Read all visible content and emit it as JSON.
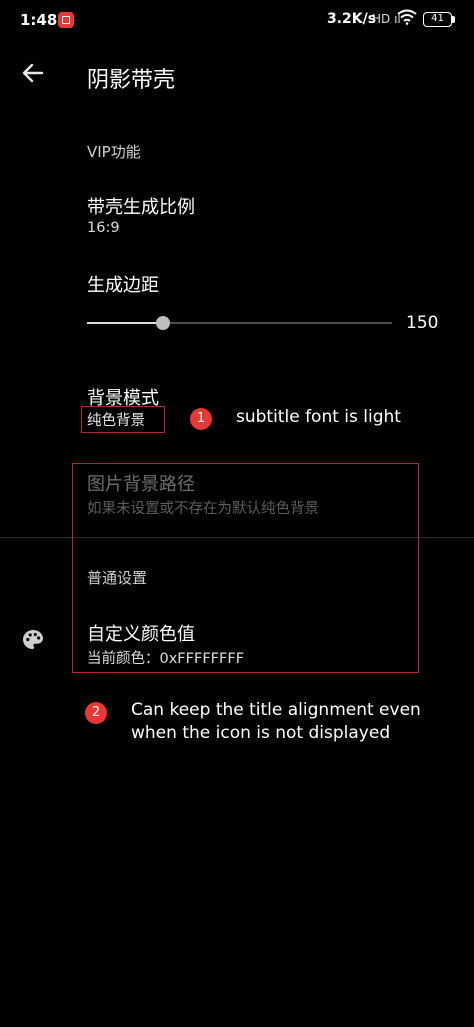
{
  "status_bar": {
    "time": "1:48",
    "net_speed": "3.2K/s",
    "signal": "HD ıl",
    "battery": "41"
  },
  "toolbar": {
    "back_icon": "arrow-left-icon",
    "title": "阴影带壳"
  },
  "sections": {
    "vip": "VIP功能",
    "general": "普通设置"
  },
  "settings": {
    "ratio": {
      "title": "带壳生成比例",
      "value": "16:9"
    },
    "margin": {
      "title": "生成边距",
      "value": "150",
      "level": 0.25
    },
    "bg_mode": {
      "title": "背景模式",
      "value": "纯色背景"
    },
    "bg_path": {
      "title": "图片背景路径",
      "summary": "如果未设置或不存在为默认纯色背景"
    },
    "custom_color": {
      "title": "自定义颜色值",
      "summary": "当前颜色：0xFFFFFFFF",
      "icon": "palette-icon"
    }
  },
  "annotations": {
    "note1_num": "1",
    "note1_text": "subtitle font is light",
    "note2_num": "2",
    "note2_line1": "Can keep the title alignment even",
    "note2_line2": "when the icon is not displayed",
    "box_color": "#b3262b",
    "dot_color": "#e53935"
  }
}
